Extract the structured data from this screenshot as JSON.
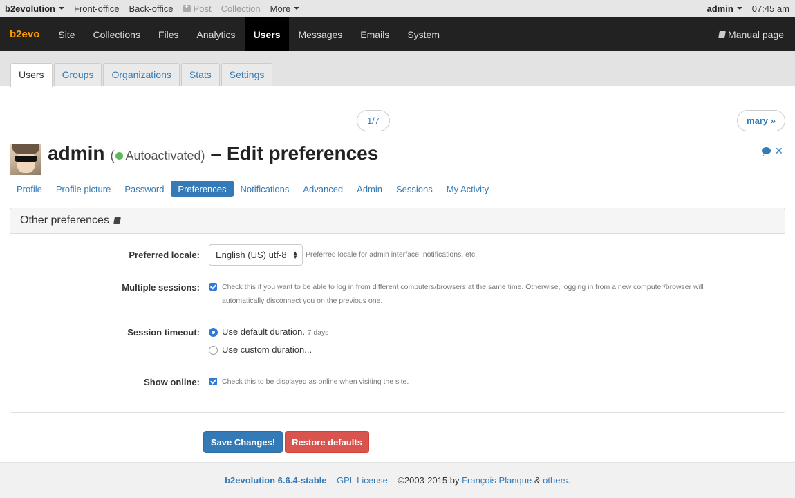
{
  "evobar": {
    "brand": "b2evolution",
    "items": [
      "Front-office",
      "Back-office",
      "Post",
      "Collection",
      "More"
    ],
    "user": "admin",
    "time": "07:45 am"
  },
  "mainnav": {
    "logo": "b2evo",
    "items": [
      "Site",
      "Collections",
      "Files",
      "Analytics",
      "Users",
      "Messages",
      "Emails",
      "System"
    ],
    "active": "Users",
    "manual": "Manual page"
  },
  "subtabs": [
    "Users",
    "Groups",
    "Organizations",
    "Stats",
    "Settings"
  ],
  "pager": {
    "count": "1/7",
    "next": "mary »"
  },
  "title": {
    "login": "admin",
    "status_open": "(",
    "status": "Autoactivated)",
    "rest": "– Edit preferences"
  },
  "usertabs": [
    "Profile",
    "Profile picture",
    "Password",
    "Preferences",
    "Notifications",
    "Advanced",
    "Admin",
    "Sessions",
    "My Activity"
  ],
  "panel": {
    "heading": "Other preferences",
    "locale": {
      "label": "Preferred locale:",
      "value": "English (US) utf-8",
      "note": "Preferred locale for admin interface, notifications, etc."
    },
    "sessions": {
      "label": "Multiple sessions:",
      "note_line1": "Check this if you want to be able to log in from different computers/browsers at the same time. Otherwise, logging in from a new computer/browser will",
      "note_line2": "automatically disconnect you on the previous one."
    },
    "timeout": {
      "label": "Session timeout:",
      "option_default": "Use default duration.",
      "option_default_note": "7 days",
      "option_custom": "Use custom duration..."
    },
    "online": {
      "label": "Show online:",
      "note": "Check this to be displayed as online when visiting the site."
    }
  },
  "buttons": {
    "save": "Save Changes!",
    "restore": "Restore defaults"
  },
  "footer": {
    "version": "b2evolution 6.6.4-stable",
    "sep1": " – ",
    "license": "GPL License",
    "copyright": " – ©2003-2015 by ",
    "author": "François Planque",
    "amp": " & ",
    "others": "others."
  }
}
